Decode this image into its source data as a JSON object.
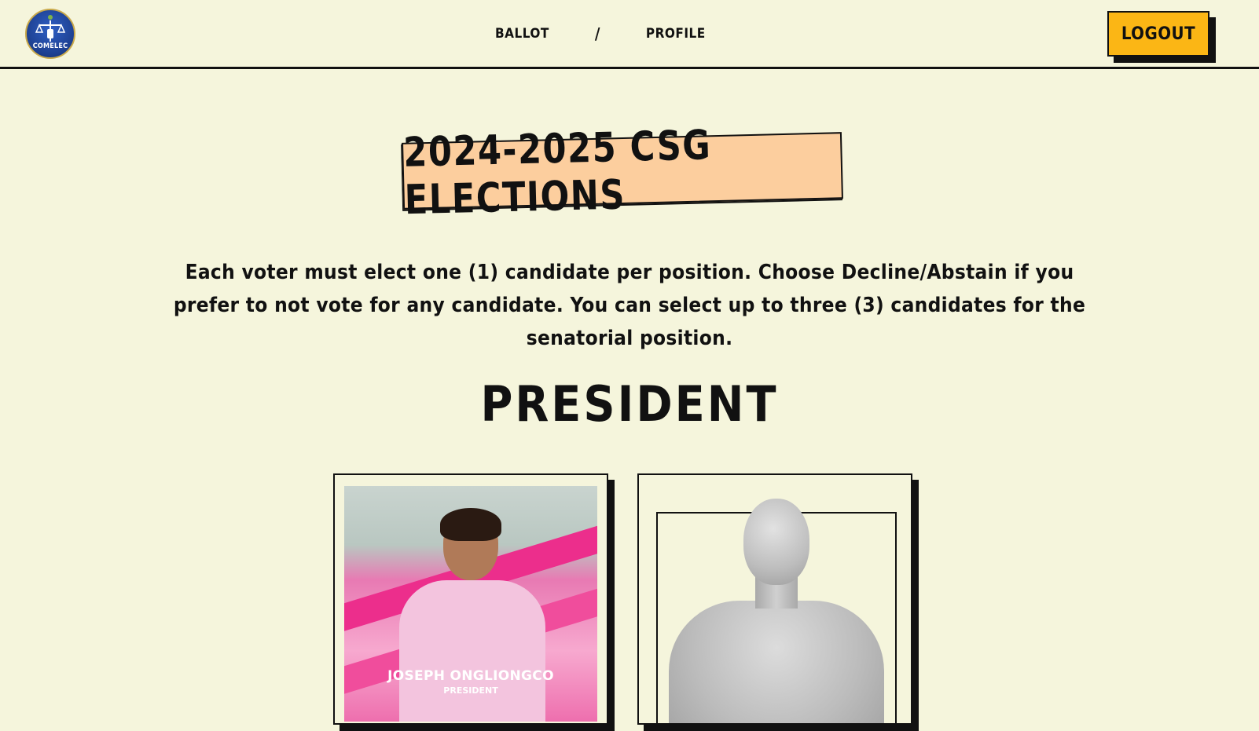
{
  "header": {
    "logo_text": "COMELEC",
    "nav": {
      "ballot": "BALLOT",
      "separator": "/",
      "profile": "PROFILE"
    },
    "logout_label": "LOGOUT"
  },
  "banner": {
    "title": "2024-2025 CSG ELECTIONS"
  },
  "instructions": "Each voter must elect one (1) candidate per position. Choose Decline/Abstain if you prefer to not vote for any candidate. You can select up to three (3) candidates for the senatorial position.",
  "position": {
    "title": "PRESIDENT",
    "candidates": [
      {
        "name": "JOSEPH ONGLIONGCO",
        "position": "PRESIDENT"
      },
      {
        "name": "",
        "position": ""
      }
    ]
  },
  "colors": {
    "background": "#f5f5dc",
    "logout_button": "#fbb615",
    "title_banner": "#fcce9e",
    "accent_pink": "#ec2e8c"
  }
}
